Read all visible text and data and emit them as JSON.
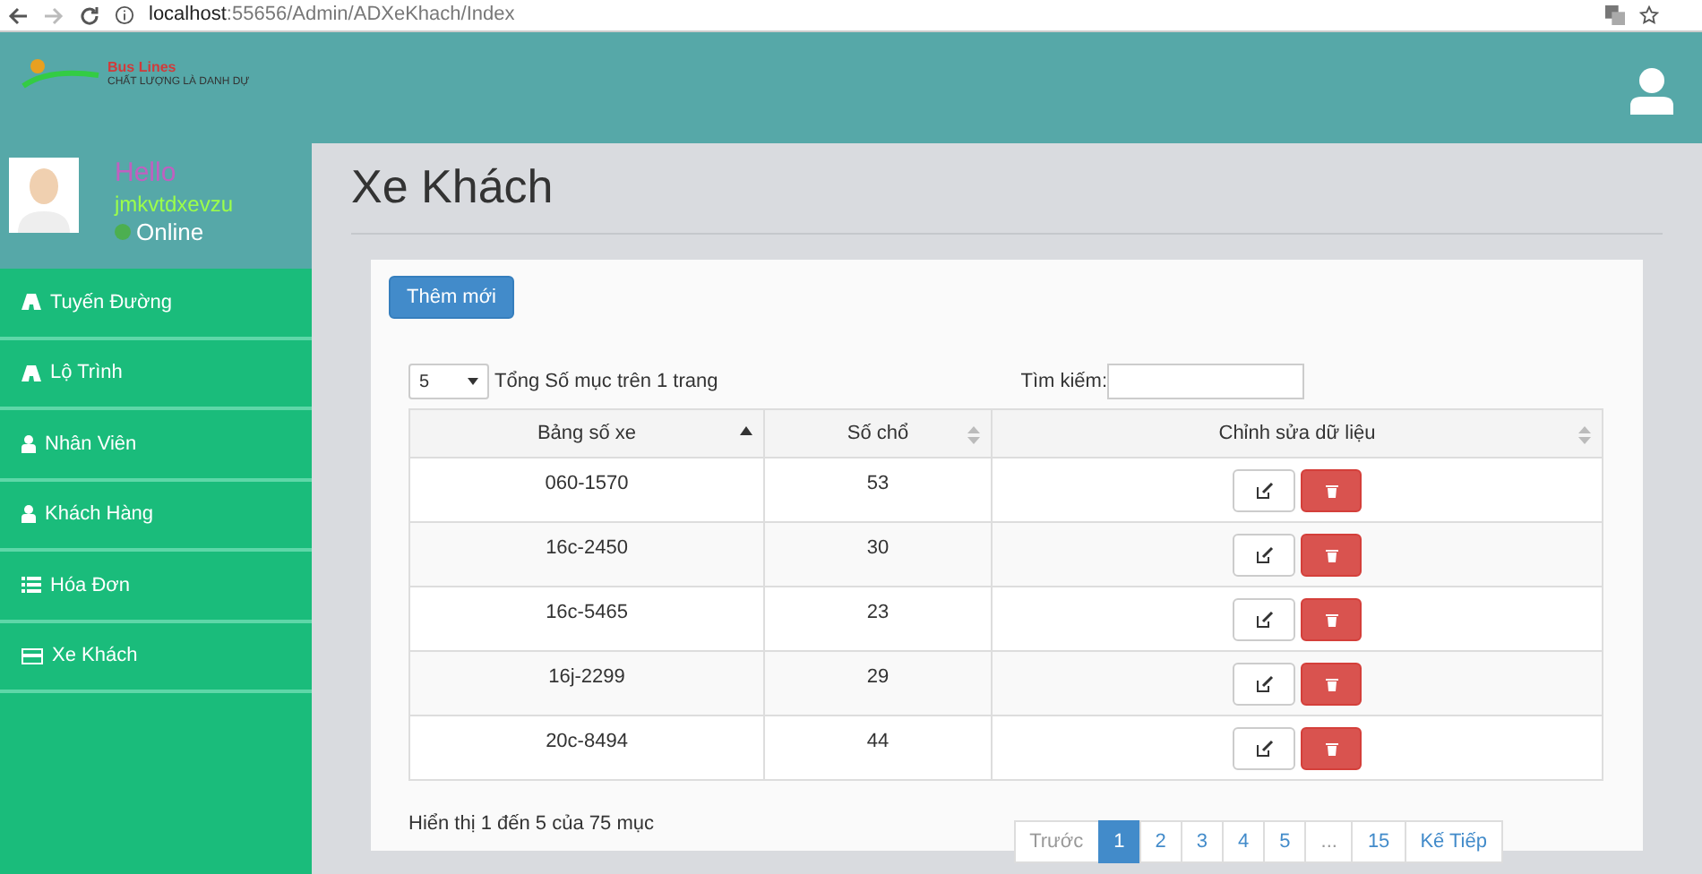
{
  "browser": {
    "url_host": "localhost",
    "url_path": ":55656/Admin/ADXeKhach/Index"
  },
  "header": {
    "logo_name": "Bus Lines",
    "logo_tagline": "CHẤT LƯỢNG LÀ DANH DỰ"
  },
  "user": {
    "greeting": "Hello",
    "username": "jmkvtdxevzu",
    "status": "Online",
    "online": true
  },
  "sidebar": {
    "items": [
      {
        "label": "Tuyến Đường",
        "kind": "road"
      },
      {
        "label": "Lộ Trình",
        "kind": "road"
      },
      {
        "label": "Nhân Viên",
        "kind": "user"
      },
      {
        "label": "Khách Hàng",
        "kind": "user"
      },
      {
        "label": "Hóa Đơn",
        "kind": "list"
      },
      {
        "label": "Xe Khách",
        "kind": "card"
      }
    ]
  },
  "page_title": "Xe Khách",
  "add_button": "Thêm mới",
  "length": {
    "value": "5",
    "label": "Tổng Số mục trên 1 trang"
  },
  "search": {
    "label": "Tìm kiếm:"
  },
  "table": {
    "columns": [
      {
        "label": "Bảng số xe",
        "sorted": true
      },
      {
        "label": "Số chổ",
        "sorted": false
      },
      {
        "label": "Chỉnh sửa dữ liệu",
        "sorted": false
      }
    ],
    "rows": [
      {
        "plate": "060-1570",
        "seats": "53"
      },
      {
        "plate": "16c-2450",
        "seats": "30"
      },
      {
        "plate": "16c-5465",
        "seats": "23"
      },
      {
        "plate": "16j-2299",
        "seats": "29"
      },
      {
        "plate": "20c-8494",
        "seats": "44"
      }
    ]
  },
  "info": "Hiển thị 1 đến 5 của 75 mục",
  "pagination": [
    {
      "label": "Trước",
      "selected": false,
      "disabled": true
    },
    {
      "label": "1",
      "selected": true,
      "disabled": false
    },
    {
      "label": "2",
      "selected": false,
      "disabled": false
    },
    {
      "label": "3",
      "selected": false,
      "disabled": false
    },
    {
      "label": "4",
      "selected": false,
      "disabled": false
    },
    {
      "label": "5",
      "selected": false,
      "disabled": false
    },
    {
      "label": "...",
      "selected": false,
      "disabled": true
    },
    {
      "label": "15",
      "selected": false,
      "disabled": false
    },
    {
      "label": "Kế Tiếp",
      "selected": false,
      "disabled": false
    }
  ]
}
